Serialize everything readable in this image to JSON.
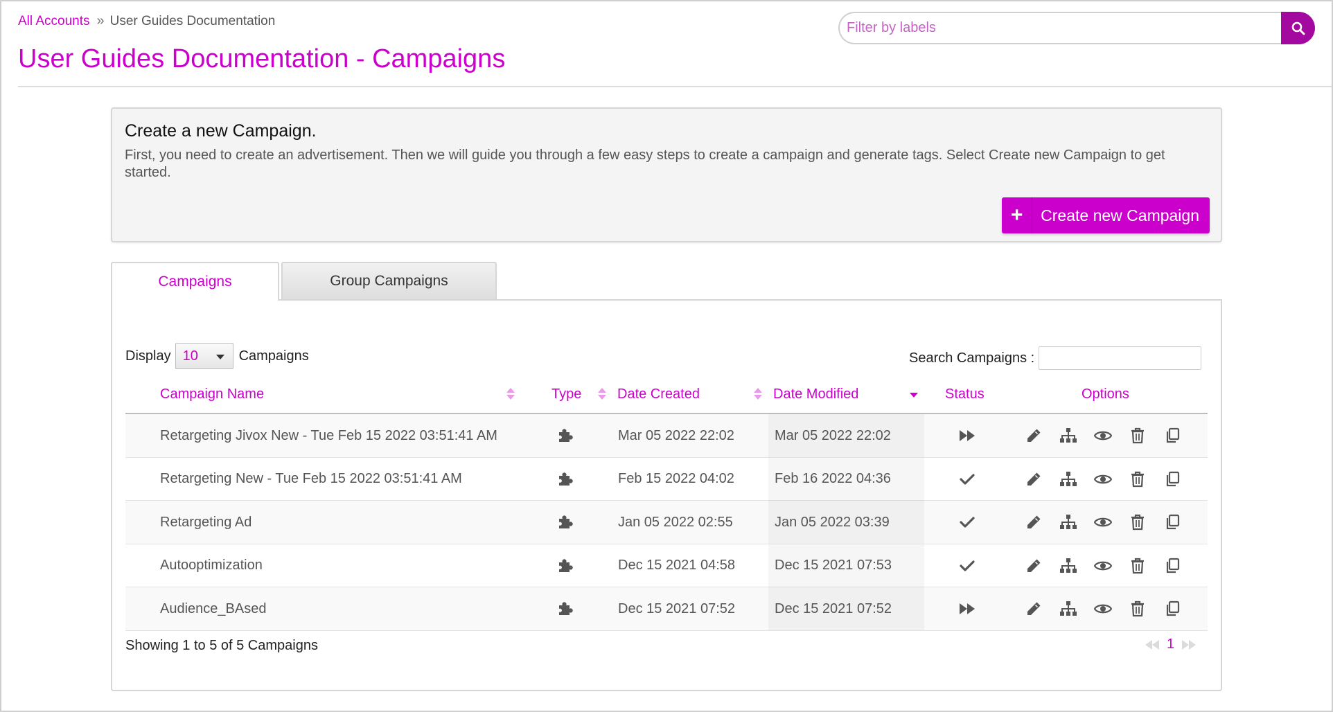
{
  "breadcrumb": {
    "root": "All Accounts",
    "separator": "»",
    "current": "User Guides Documentation"
  },
  "page_title": "User Guides Documentation - Campaigns",
  "filter": {
    "placeholder": "Filter by labels",
    "button_icon": "search-icon"
  },
  "create_card": {
    "title": "Create a new Campaign.",
    "description": "First, you need to create an advertisement. Then we will guide you through a few easy steps to create a campaign and generate tags. Select Create new Campaign to get started.",
    "button_label": "Create new Campaign",
    "button_icon": "plus-icon"
  },
  "tabs": [
    {
      "label": "Campaigns",
      "active": true
    },
    {
      "label": "Group Campaigns",
      "active": false
    }
  ],
  "display": {
    "prefix": "Display",
    "value": "10",
    "suffix": "Campaigns"
  },
  "search": {
    "label": "Search Campaigns :",
    "value": ""
  },
  "table": {
    "columns": {
      "name": "Campaign Name",
      "type": "Type",
      "created": "Date Created",
      "modified": "Date Modified",
      "status": "Status",
      "options": "Options"
    },
    "sorted_by": "Date Modified",
    "sort_direction": "desc",
    "rows": [
      {
        "name": "Retargeting Jivox New - Tue Feb 15 2022 03:51:41 AM",
        "type_icon": "puzzle-icon",
        "created": "Mar 05 2022 22:02",
        "modified": "Mar 05 2022 22:02",
        "status_icon": "fast-forward-icon"
      },
      {
        "name": "Retargeting New - Tue Feb 15 2022 03:51:41 AM",
        "type_icon": "puzzle-icon",
        "created": "Feb 15 2022 04:02",
        "modified": "Feb 16 2022 04:36",
        "status_icon": "check-icon"
      },
      {
        "name": "Retargeting Ad",
        "type_icon": "puzzle-icon",
        "created": "Jan 05 2022 02:55",
        "modified": "Jan 05 2022 03:39",
        "status_icon": "check-icon"
      },
      {
        "name": "Autooptimization",
        "type_icon": "puzzle-icon",
        "created": "Dec 15 2021 04:58",
        "modified": "Dec 15 2021 07:53",
        "status_icon": "check-icon"
      },
      {
        "name": "Audience_BAsed",
        "type_icon": "puzzle-icon",
        "created": "Dec 15 2021 07:52",
        "modified": "Dec 15 2021 07:52",
        "status_icon": "fast-forward-icon"
      }
    ],
    "option_icons": [
      "edit-icon",
      "hierarchy-icon",
      "view-icon",
      "delete-icon",
      "copy-icon"
    ]
  },
  "footer": {
    "info": "Showing 1 to 5 of 5 Campaigns",
    "current_page": "1",
    "prev_icon": "rewind-icon",
    "next_icon": "fast-forward-icon"
  },
  "colors": {
    "accent": "#cc00cc",
    "search_button": "#a3089f",
    "icon": "#555555"
  }
}
